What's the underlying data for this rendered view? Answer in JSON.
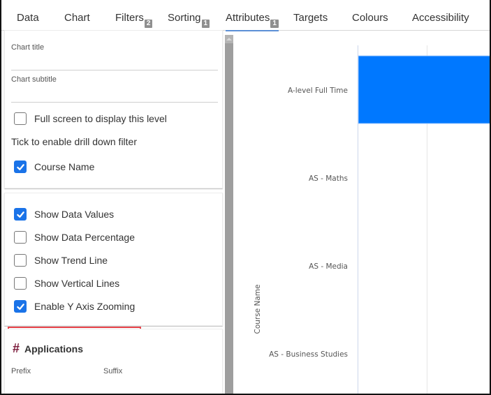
{
  "tabs": [
    {
      "label": "Data",
      "badge": null,
      "active": false
    },
    {
      "label": "Chart",
      "badge": null,
      "active": false
    },
    {
      "label": "Filters",
      "badge": "2",
      "active": false
    },
    {
      "label": "Sorting",
      "badge": "1",
      "active": false
    },
    {
      "label": "Attributes",
      "badge": "1",
      "active": true
    },
    {
      "label": "Targets",
      "badge": null,
      "active": false
    },
    {
      "label": "Colours",
      "badge": null,
      "active": false
    },
    {
      "label": "Accessibility",
      "badge": null,
      "active": false
    }
  ],
  "settings": {
    "chart_title": {
      "label": "Chart title",
      "value": ""
    },
    "chart_subtitle": {
      "label": "Chart subtitle",
      "value": ""
    },
    "full_screen": {
      "label": "Full screen to display this level",
      "checked": false
    },
    "drill_down_hint": "Tick to enable drill down filter",
    "course_name": {
      "label": "Course Name",
      "checked": true
    }
  },
  "display_options": [
    {
      "label": "Show Data Values",
      "checked": true
    },
    {
      "label": "Show Data Percentage",
      "checked": false
    },
    {
      "label": "Show Trend Line",
      "checked": false
    },
    {
      "label": "Show Vertical Lines",
      "checked": false
    },
    {
      "label": "Enable Y Axis Zooming",
      "checked": true,
      "highlighted": true
    }
  ],
  "applications": {
    "title": "Applications",
    "icon": "hash-icon",
    "prefix_label": "Prefix",
    "suffix_label": "Suffix"
  },
  "colors": {
    "accent": "#1a73e8",
    "bar": "#0078ff",
    "highlight": "#e8434a",
    "tab_underline": "#5b8fd6"
  },
  "chart_data": {
    "type": "bar",
    "orientation": "horizontal",
    "ylabel": "Course Name",
    "categories": [
      "A-level Full Time",
      "AS - Maths",
      "AS - Media",
      "AS - Business Studies"
    ],
    "values": [
      null,
      null,
      null,
      null
    ],
    "note": "Only the first bar (A-level Full Time) is visible; it extends beyond the cropped right edge so its value cannot be read. Other categories show no visible bar.",
    "bar_visible": [
      true,
      false,
      false,
      false
    ],
    "grid": true
  }
}
